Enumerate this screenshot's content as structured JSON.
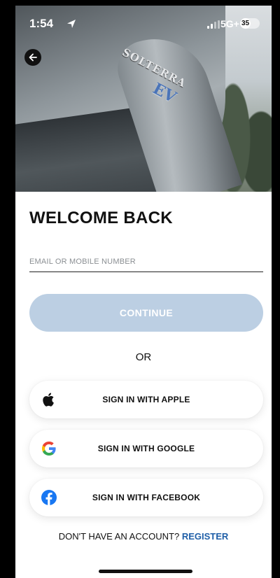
{
  "status_bar": {
    "time": "1:54",
    "network": "5G+",
    "battery_level": "35"
  },
  "header": {
    "title": "WELCOME BACK"
  },
  "hero": {
    "badge_text": "SOLTERRA",
    "badge_ev": "EV"
  },
  "form": {
    "email_placeholder": "EMAIL OR MOBILE NUMBER",
    "email_value": "",
    "continue_label": "CONTINUE"
  },
  "divider": {
    "or_label": "OR"
  },
  "social_buttons": [
    {
      "label": "SIGN IN WITH APPLE",
      "icon": "apple-icon"
    },
    {
      "label": "SIGN IN WITH GOOGLE",
      "icon": "google-icon"
    },
    {
      "label": "SIGN IN WITH FACEBOOK",
      "icon": "facebook-icon"
    }
  ],
  "footer": {
    "prompt": "DON'T HAVE AN ACCOUNT?",
    "register_label": "REGISTER"
  },
  "colors": {
    "continue_disabled": "#bccfe3",
    "register_link": "#1f5fa8",
    "facebook_blue": "#1877f2"
  }
}
